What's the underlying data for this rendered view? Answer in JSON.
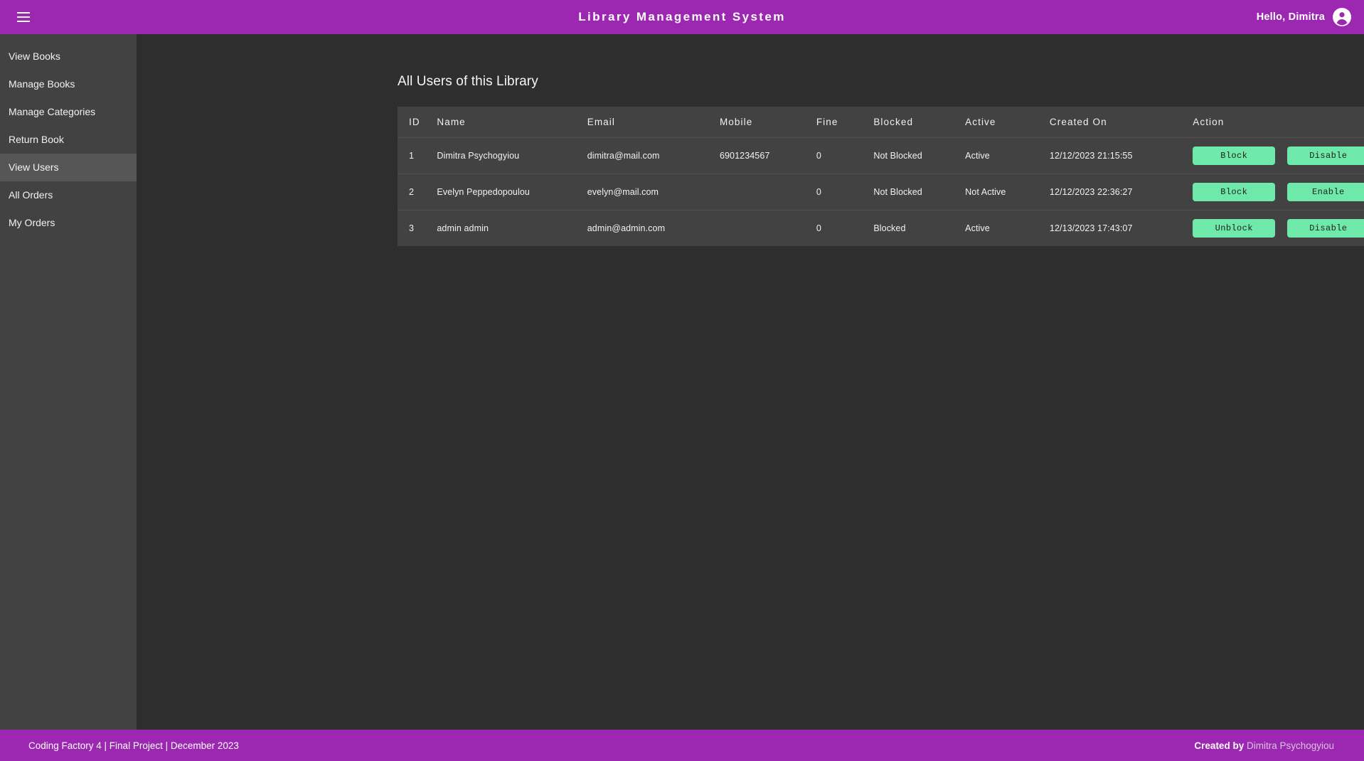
{
  "topbar": {
    "menu_icon": "hamburger-icon",
    "title": "Library Management System",
    "greeting": "Hello, Dimitra",
    "account_icon": "account-circle-icon",
    "background_color": "#9c27b0"
  },
  "sidebar": {
    "items": [
      {
        "label": "View Books",
        "active": false
      },
      {
        "label": "Manage Books",
        "active": false
      },
      {
        "label": "Manage Categories",
        "active": false
      },
      {
        "label": "Return Book",
        "active": false
      },
      {
        "label": "View Users",
        "active": true
      },
      {
        "label": "All Orders",
        "active": false
      },
      {
        "label": "My Orders",
        "active": false
      }
    ],
    "background_color": "#424242",
    "active_color": "#565656"
  },
  "main": {
    "page_title": "All Users of this Library",
    "table": {
      "columns": [
        "ID",
        "Name",
        "Email",
        "Mobile",
        "Fine",
        "Blocked",
        "Active",
        "Created On",
        "Action"
      ],
      "rows": [
        {
          "id": "1",
          "name": "Dimitra Psychogyiou",
          "email": "dimitra@mail.com",
          "mobile": "6901234567",
          "fine": "0",
          "blocked": "Not Blocked",
          "active": "Active",
          "created_on": "12/12/2023 21:15:55",
          "action_primary": "Block",
          "action_secondary": "Disable"
        },
        {
          "id": "2",
          "name": "Evelyn Peppedopoulou",
          "email": "evelyn@mail.com",
          "mobile": "",
          "fine": "0",
          "blocked": "Not Blocked",
          "active": "Not Active",
          "created_on": "12/12/2023 22:36:27",
          "action_primary": "Block",
          "action_secondary": "Enable"
        },
        {
          "id": "3",
          "name": "admin admin",
          "email": "admin@admin.com",
          "mobile": "",
          "fine": "0",
          "blocked": "Blocked",
          "active": "Active",
          "created_on": "12/13/2023 17:43:07",
          "action_primary": "Unblock",
          "action_secondary": "Disable"
        }
      ],
      "row_background": "#424242",
      "button_color": "#6fe9aa"
    }
  },
  "footer": {
    "left_text": "Coding Factory 4 | Final Project | December 2023",
    "right_prefix": "Created by ",
    "right_author": "Dimitra Psychogyiou",
    "background_color": "#9c27b0"
  }
}
